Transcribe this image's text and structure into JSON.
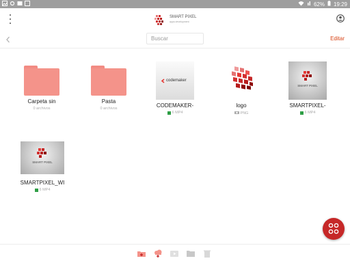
{
  "status_bar": {
    "battery_percent": "62%",
    "time": "19:29"
  },
  "header": {
    "brand_name": "SMART PIXEL",
    "brand_tagline": "apps development"
  },
  "toolbar": {
    "search_placeholder": "Buscar",
    "edit_label": "Editar"
  },
  "items": [
    {
      "type": "folder",
      "name": "Carpeta sin",
      "meta": "0 archivos"
    },
    {
      "type": "folder",
      "name": "Pasta",
      "meta": "0 archivos"
    },
    {
      "type": "video",
      "name": "CODEMAKER-",
      "meta": "6 MP4",
      "thumb_text": "codemaker"
    },
    {
      "type": "image",
      "name": "logo",
      "meta": "PNG"
    },
    {
      "type": "video",
      "name": "SMARTPIXEL-",
      "meta": "6 MP4",
      "thumb_text": "SMART PIXEL"
    },
    {
      "type": "video",
      "name": "SMARTPIXEL_WI",
      "meta": "6 MP4",
      "thumb_text": "SMART PIXEL"
    }
  ],
  "colors": {
    "accent": "#d84315",
    "folder": "#f4938a",
    "fab": "#c62828",
    "video_badge": "#2e9e45"
  }
}
